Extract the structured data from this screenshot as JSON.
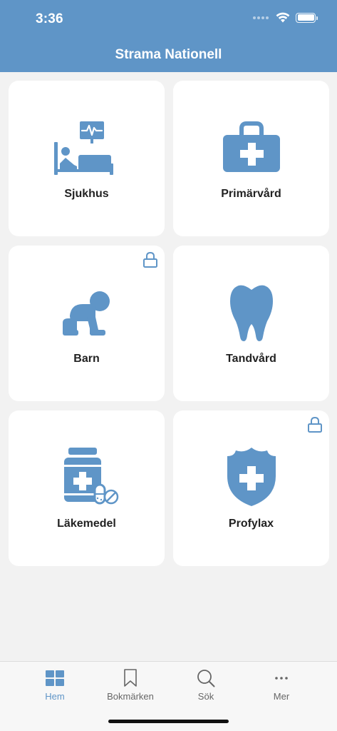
{
  "status_bar": {
    "time": "3:36"
  },
  "header": {
    "title": "Strama Nationell"
  },
  "tiles": [
    {
      "label": "Sjukhus",
      "icon": "hospital-bed-icon",
      "locked": false
    },
    {
      "label": "Primärvård",
      "icon": "medical-kit-icon",
      "locked": false
    },
    {
      "label": "Barn",
      "icon": "crawling-baby-icon",
      "locked": true
    },
    {
      "label": "Tandvård",
      "icon": "tooth-icon",
      "locked": false
    },
    {
      "label": "Läkemedel",
      "icon": "medicine-bottle-icon",
      "locked": false
    },
    {
      "label": "Profylax",
      "icon": "shield-cross-icon",
      "locked": true
    }
  ],
  "tabbar": {
    "items": [
      {
        "label": "Hem",
        "icon": "grid-icon",
        "active": true
      },
      {
        "label": "Bokmärken",
        "icon": "bookmark-icon",
        "active": false
      },
      {
        "label": "Sök",
        "icon": "search-icon",
        "active": false
      },
      {
        "label": "Mer",
        "icon": "more-icon",
        "active": false
      }
    ]
  },
  "colors": {
    "accent": "#5f95c7",
    "icon": "#5f95c7",
    "background": "#f2f2f2",
    "tile": "#ffffff"
  }
}
